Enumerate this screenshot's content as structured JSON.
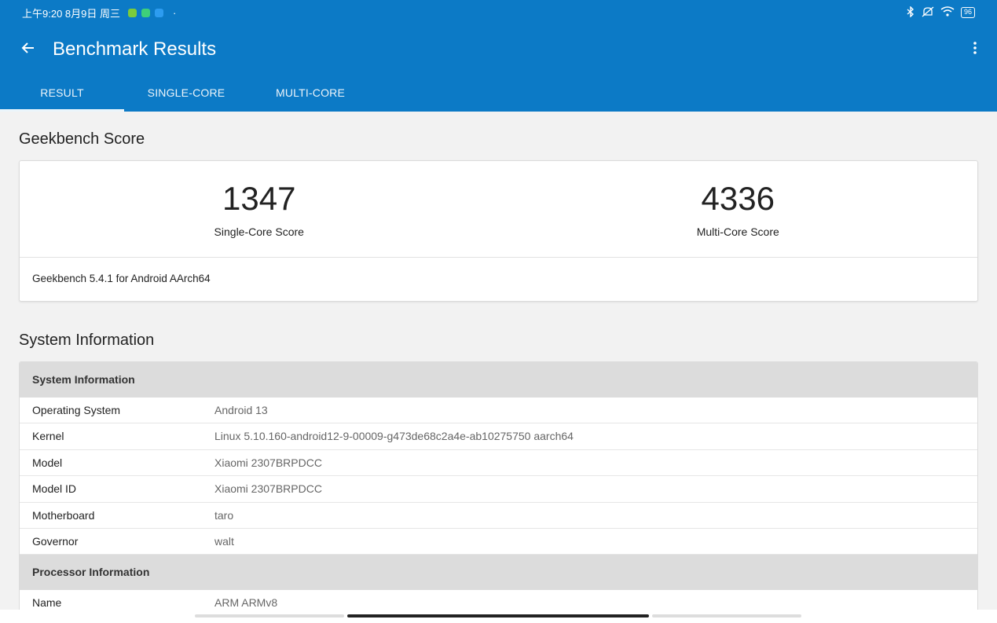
{
  "status_bar": {
    "time": "上午9:20 8月9日 周三",
    "notification_dot": "·",
    "battery": "96",
    "icons": [
      "bluetooth-icon",
      "mute-icon",
      "wifi-icon",
      "battery-icon"
    ],
    "app_icon_colors": [
      "#7ccb3a",
      "#3ecf7a",
      "#2d9cf0"
    ]
  },
  "app_bar": {
    "title": "Benchmark Results",
    "back_icon": "arrow-left-icon",
    "menu_icon": "more-vert-icon",
    "background_color": "#0c7ac6"
  },
  "tabs": [
    {
      "label": "RESULT",
      "active": true
    },
    {
      "label": "SINGLE-CORE",
      "active": false
    },
    {
      "label": "MULTI-CORE",
      "active": false
    }
  ],
  "geekbench_score": {
    "heading": "Geekbench Score",
    "single_core": {
      "value": "1347",
      "label": "Single-Core Score"
    },
    "multi_core": {
      "value": "4336",
      "label": "Multi-Core Score"
    },
    "version": "Geekbench 5.4.1 for Android AArch64"
  },
  "system_information": {
    "heading": "System Information",
    "groups": [
      {
        "title": "System Information",
        "rows": [
          {
            "key": "Operating System",
            "value": "Android 13"
          },
          {
            "key": "Kernel",
            "value": "Linux 5.10.160-android12-9-00009-g473de68c2a4e-ab10275750 aarch64"
          },
          {
            "key": "Model",
            "value": "Xiaomi 2307BRPDCC"
          },
          {
            "key": "Model ID",
            "value": "Xiaomi 2307BRPDCC"
          },
          {
            "key": "Motherboard",
            "value": "taro"
          },
          {
            "key": "Governor",
            "value": "walt"
          }
        ]
      },
      {
        "title": "Processor Information",
        "rows": [
          {
            "key": "Name",
            "value": "ARM ARMv8"
          }
        ]
      }
    ]
  }
}
